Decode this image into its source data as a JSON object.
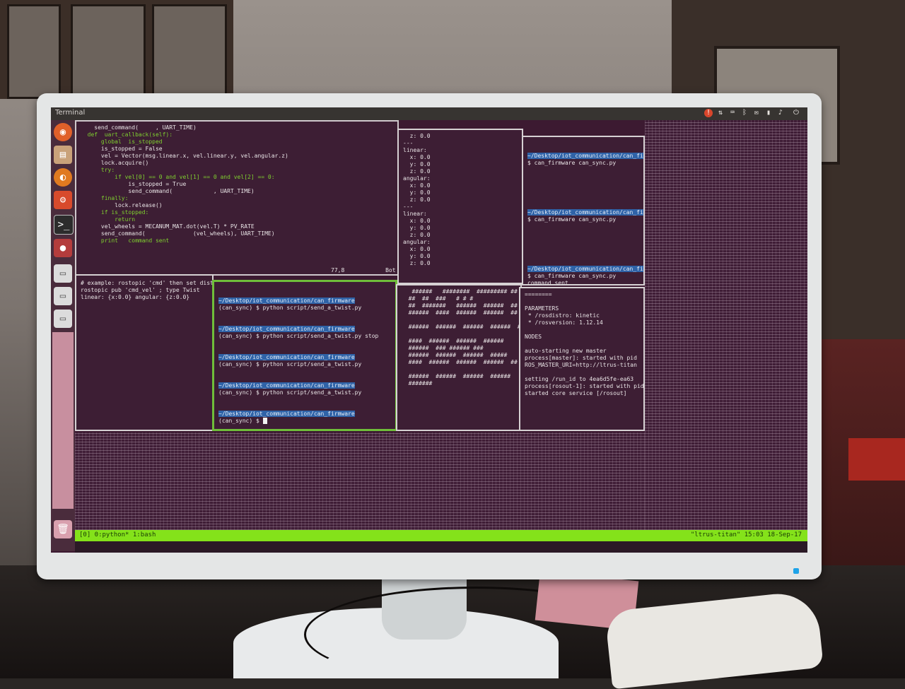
{
  "topbar": {
    "title": "Terminal"
  },
  "tray": {
    "alert_icon": "alert-icon",
    "clock": ""
  },
  "launcher": {
    "items": [
      {
        "icon": "ubuntu-logo-icon",
        "color": "#e0602a"
      },
      {
        "icon": "files-icon",
        "color": "#c9a27a"
      },
      {
        "icon": "firefox-icon",
        "color": "#e07a20"
      },
      {
        "icon": "settings-icon",
        "color": "#d84a2c"
      },
      {
        "icon": "terminal-icon",
        "color": "#2c2c2c"
      },
      {
        "icon": "app-icon",
        "color": "#c44"
      },
      {
        "icon": "drive-icon-1",
        "color": "#dcdcdc"
      },
      {
        "icon": "drive-icon-2",
        "color": "#dcdcdc"
      },
      {
        "icon": "drive-icon-3",
        "color": "#dcdcdc"
      },
      {
        "icon": "trash-icon",
        "color": "#d9a0ae"
      }
    ]
  },
  "panes": {
    "editor": {
      "lines": [
        "    send_command(     , UART_TIME)",
        "  def  uart_callback(self):",
        "      global  is_stopped",
        "      is_stopped = False",
        "      vel = Vector(msg.linear.x, vel.linear.y, vel.angular.z)",
        "      lock.acquire()",
        "      try:",
        "          if vel[0] == 0 and vel[1] == 0 and vel[2] == 0:",
        "              is_stopped = True",
        "              send_command(            , UART_TIME)",
        "      finally:",
        "          lock.release()",
        "      if is_stopped:",
        "          return",
        "      vel_wheels = MECANUM_MAT.dot(vel.T) * PV_RATE",
        "      send_command(              (vel_wheels), UART_TIME)",
        "      print   command sent"
      ],
      "ruler": "77,8            Bot"
    },
    "topic_echo": {
      "lines": [
        "  z: 0.0",
        "---",
        "linear:",
        "  x: 0.0",
        "  y: 0.0",
        "  z: 0.0",
        "angular:",
        "  x: 0.0",
        "  y: 0.0",
        "  z: 0.0",
        "---",
        "linear:",
        "  x: 0.0",
        "  y: 0.0",
        "  z: 0.0",
        "angular:",
        "  x: 0.0",
        "  y: 0.0",
        "  z: 0.0"
      ]
    },
    "firmware": {
      "lines": [
        "~/Desktop/iot_communication/can_firmware",
        "$ can_firmware can_sync.py",
        "",
        "",
        "",
        "",
        "",
        "",
        "~/Desktop/iot_communication/can_firmware",
        "$ can_firmware can_sync.py",
        "",
        "",
        "",
        "",
        "",
        "",
        "~/Desktop/iot_communication/can_firmware",
        "$ can_firmware can_sync.py",
        "command sent"
      ]
    },
    "bottom_left": {
      "lines": [
        "# example: rostopic 'cmd' then set dist",
        "rostopic pub 'cmd_vel' ; type Twist ",
        "linear: {x:0.0} angular: {z:0.0}"
      ]
    },
    "active": {
      "lines": [
        "~/Desktop/iot_communication/can_firmware",
        "(can_sync) $ python script/send_a_twist.py",
        "",
        "",
        "~/Desktop/iot_communication/can_firmware",
        "(can_sync) $ python script/send_a_twist.py stop",
        "",
        "",
        "~/Desktop/iot_communication/can_firmware",
        "(can_sync) $ python script/send_a_twist.py",
        "",
        "",
        "~/Desktop/iot_communication/can_firmware",
        "(can_sync) $ python script/send_a_twist.py",
        "",
        "",
        "~/Desktop/iot_communication/can_firmware",
        "(can_sync) $ "
      ]
    },
    "logs": {
      "lines": [
        "   ######   ########  ######### ##",
        "  ##  ##  ###   # # #",
        "  ##  #######   ######  ######  ##",
        "  ######  ####  ######  ######  ##",
        "",
        "  ######  ######  ######  ######  ##",
        "",
        "  ####  ######  ######  ######",
        "  ######  ### ###### ###",
        "  ######  ######  ######  #####",
        "  ####  ######  ######  ######  ##",
        "",
        "  ######  ######  ######  ######",
        "  #######"
      ]
    },
    "roscore": {
      "lines": [
        "========",
        "",
        "PARAMETERS",
        " * /rosdistro: kinetic",
        " * /rosversion: 1.12.14",
        "",
        "NODES",
        "",
        "auto-starting new master",
        "process[master]: started with pid",
        "ROS_MASTER_URI=http://ltrus-titan",
        "",
        "setting /run_id to 4ea6d5fe-ea63",
        "process[rosout-1]: started with pid",
        "started core service [/rosout]"
      ]
    }
  },
  "status_bar": {
    "left": "[0] 0:python* 1:bash",
    "right": "\"ltrus-titan\" 15:03 18-Sep-17"
  }
}
